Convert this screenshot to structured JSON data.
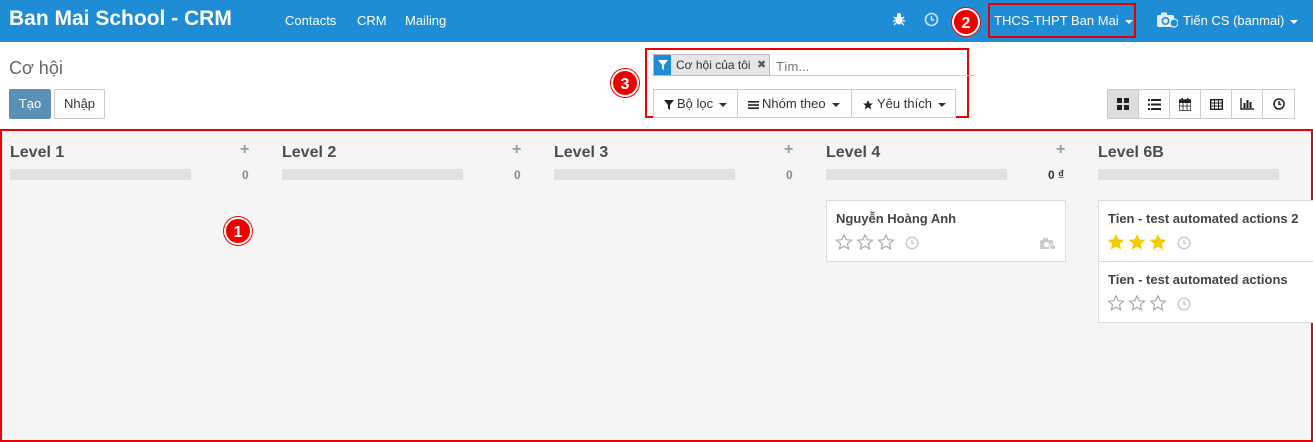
{
  "app": {
    "title": "Ban Mai School - CRM"
  },
  "nav": [
    "Contacts",
    "CRM",
    "Mailing"
  ],
  "company": {
    "name": "THCS-THPT Ban Mai"
  },
  "user": {
    "name": "Tiến CS (banmai)"
  },
  "page": {
    "breadcrumb": "Cơ hội"
  },
  "buttons": {
    "create": "Tạo",
    "import": "Nhập"
  },
  "search": {
    "facet": "Cơ hội của tôi",
    "placeholder": "Tìm...",
    "filters_label": "Bộ lọc",
    "group_label": "Nhóm theo",
    "favorites_label": "Yêu thích"
  },
  "annotations": [
    "1",
    "2",
    "3"
  ],
  "columns": [
    {
      "title": "Level 1",
      "total": "0",
      "add": "+"
    },
    {
      "title": "Level 2",
      "total": "0",
      "add": "+"
    },
    {
      "title": "Level 3",
      "total": "0",
      "add": "+"
    },
    {
      "title": "Level 4",
      "total": "0 ₫",
      "add": "+"
    },
    {
      "title": "Level 6B",
      "total": "",
      "add": ""
    }
  ],
  "cards": [
    {
      "title": "Nguyễn Hoàng Anh",
      "stars": 0
    },
    {
      "title": "Tien - test automated actions 2",
      "stars": 3
    },
    {
      "title": "Tien - test automated actions",
      "stars": 0
    }
  ],
  "colors": {
    "topbar": "#1f8dd6",
    "annotation": "#e00000",
    "star": "#f3cc00",
    "primary_btn": "#5b8fb5"
  }
}
